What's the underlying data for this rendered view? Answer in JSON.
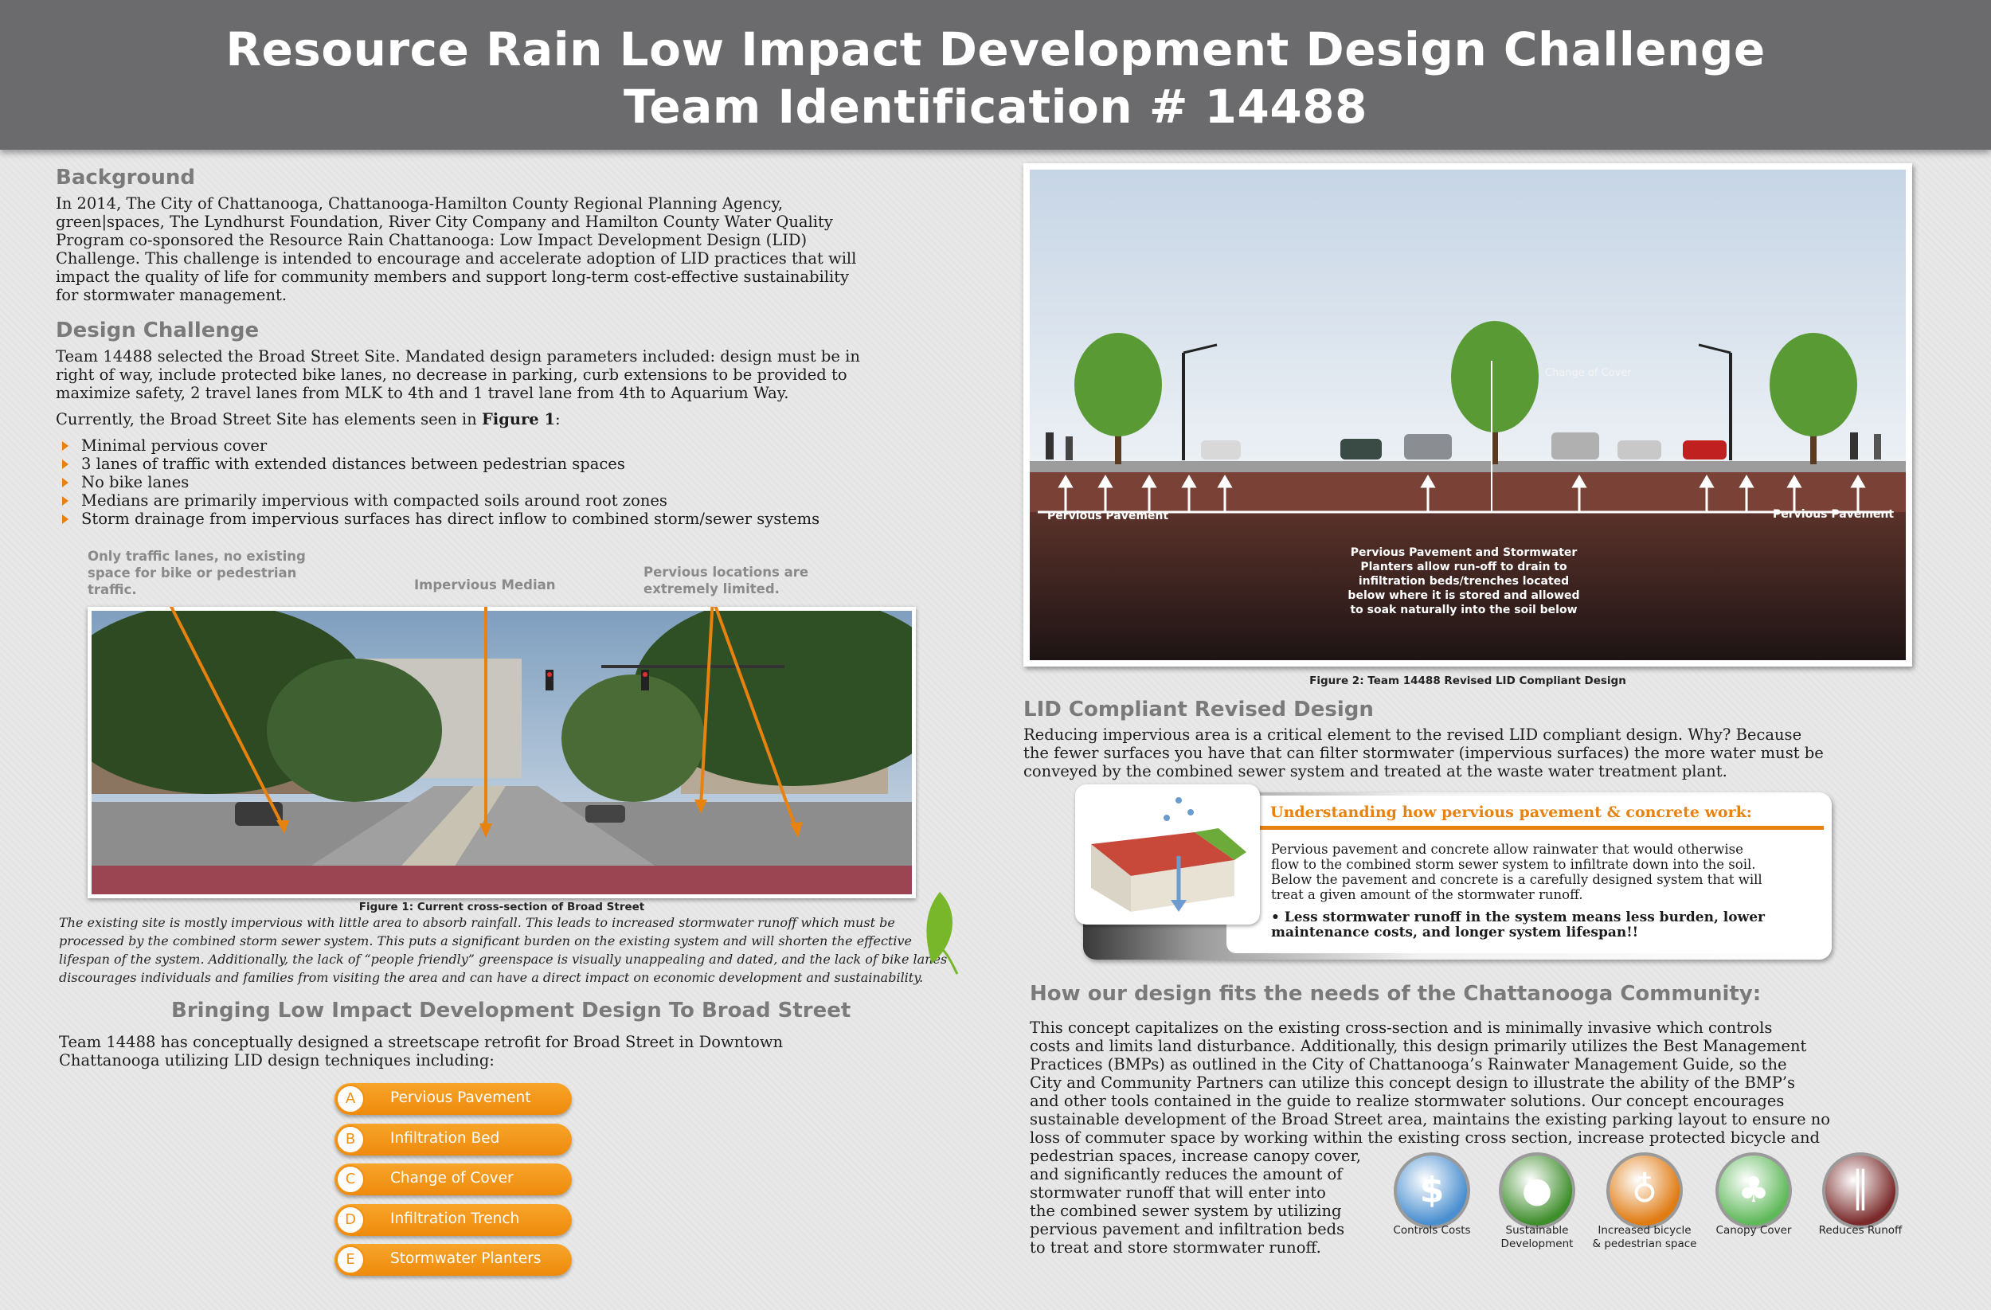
{
  "header": {
    "title_line1": "Resource Rain Low Impact  Development Design Challenge",
    "title_line2": "Team Identification # 14488"
  },
  "background": {
    "heading": "Background",
    "lines": [
      "In 2014, The City of Chattanooga, Chattanooga-Hamilton County Regional Planning Agency,",
      "green|spaces, The Lyndhurst Foundation, River City Company and Hamilton County Water Quality",
      "Program co-sponsored the Resource Rain Chattanooga: Low Impact Development Design (LID)",
      "Challenge. This challenge is intended to encourage and accelerate adoption of LID practices that will",
      "impact the quality of life for community members and support long-term cost-effective sustainability",
      "for stormwater management."
    ]
  },
  "design_challenge": {
    "heading": "Design Challenge",
    "lines": [
      "Team 14488 selected the Broad Street Site. Mandated design parameters included: design must be in",
      "right of way, include protected bike lanes, no decrease in parking, curb extensions to be provided to",
      "maximize safety, 2 travel lanes from MLK to 4th and 1 travel lane from 4th to Aquarium Way."
    ],
    "intro_prefix": "Currently, the Broad Street Site has elements seen in ",
    "intro_bold": "Figure 1",
    "intro_suffix": ":",
    "bullets": [
      "Minimal pervious cover",
      "3 lanes of traffic with extended distances between pedestrian spaces",
      "No bike lanes",
      "Medians are primarily impervious with compacted soils around root zones",
      "Storm drainage from impervious surfaces has direct inflow to combined storm/sewer systems"
    ]
  },
  "figure1": {
    "callout_left": [
      "Only traffic lanes, no existing",
      "space for bike or pedestrian",
      "traffic."
    ],
    "callout_mid": "Impervious Median",
    "callout_right": [
      "Pervious locations are",
      "extremely limited."
    ],
    "caption": "Figure 1:  Current cross-section of Broad Street",
    "italic_lines": [
      "The existing site is mostly impervious with little area to absorb rainfall.  This leads to increased stormwater runoff which must be",
      "processed by the combined storm sewer system.  This puts a significant burden on the existing system and will shorten the effective",
      "lifespan of the system.  Additionally, the lack of “people friendly” greenspace is visually unappealing and dated, and the lack of bike lanes",
      "discourages individuals and families from visiting the area and can have a direct impact on economic development and sustainability."
    ]
  },
  "bringing": {
    "heading": "Bringing Low Impact Development Design To Broad Street",
    "lines": [
      "Team 14488 has conceptually designed a streetscape retrofit for Broad Street in Downtown",
      "Chattanooga utilizing LID design techniques including:"
    ],
    "items": [
      {
        "letter": "A",
        "label": "Pervious Pavement"
      },
      {
        "letter": "B",
        "label": "Infiltration Bed"
      },
      {
        "letter": "C",
        "label": "Change of Cover"
      },
      {
        "letter": "D",
        "label": "Infiltration Trench"
      },
      {
        "letter": "E",
        "label": "Stormwater Planters"
      }
    ]
  },
  "figure2": {
    "label_left": "Pervious Pavement",
    "label_right": "Pervious Pavement",
    "label_cover": "Change of Cover",
    "note_lines": [
      "Pervious Pavement and Stormwater",
      "Planters allow run-off to drain to",
      "infiltration beds/trenches located",
      "below where it is stored and allowed",
      "to soak naturally into the soil below"
    ],
    "caption": "Figure 2:  Team 14488 Revised LID Compliant Design"
  },
  "lid": {
    "heading": "LID Compliant Revised Design",
    "lines": [
      "Reducing impervious area is a critical element to the revised LID compliant design. Why?  Because",
      "the fewer surfaces you have that can filter stormwater (impervious surfaces) the more water must be",
      "conveyed by the combined sewer system and treated at the waste water treatment plant."
    ]
  },
  "pervious_box": {
    "title": "Understanding how pervious pavement & concrete work:",
    "lines": [
      "Pervious pavement and concrete allow rainwater that would otherwise",
      "flow to the combined storm sewer system to infiltrate down into the soil.",
      "Below the pavement and concrete is a carefully designed system that will",
      "treat a given amount of the stormwater runoff."
    ],
    "bold_lines": [
      "• Less stormwater runoff in the system means less burden, lower",
      "maintenance costs, and longer system lifespan!!"
    ]
  },
  "community": {
    "heading": "How our design fits the needs of the Chattanooga Community:",
    "full_lines": [
      "This concept capitalizes on the existing cross-section and is minimally invasive which controls",
      "costs and limits land disturbance. Additionally, this design primarily utilizes the Best Management",
      "Practices (BMPs) as outlined in the City of Chattanooga’s Rainwater Management Guide, so the",
      "City and Community Partners can utilize this concept design to illustrate the ability of the BMP’s",
      "and other tools contained in the guide to realize stormwater solutions.  Our concept encourages",
      "sustainable development of the Broad Street area, maintains the existing parking layout to ensure no",
      "loss of commuter space by working within the existing cross section, increase protected bicycle and"
    ],
    "short_lines": [
      "pedestrian spaces, increase canopy cover,",
      "and significantly reduces the amount of",
      "stormwater runoff that will enter into",
      "the combined sewer system by utilizing",
      "pervious pavement and infiltration beds",
      "to treat and store stormwater runoff."
    ],
    "icons": [
      {
        "name": "dollar-icon",
        "label1": "Controls Costs",
        "label2": "",
        "color": "#4a8fd0"
      },
      {
        "name": "globe-icon",
        "label1": "Sustainable",
        "label2": "Development",
        "color": "#3f8e2c"
      },
      {
        "name": "bicycle-icon",
        "label1": "Increased bicycle",
        "label2": "& pedestrian space",
        "color": "#e07b12"
      },
      {
        "name": "tree-icon",
        "label1": "Canopy Cover",
        "label2": "",
        "color": "#5fb95a"
      },
      {
        "name": "road-icon",
        "label1": "Reduces Runoff",
        "label2": "",
        "color": "#7a2a2a"
      }
    ]
  }
}
